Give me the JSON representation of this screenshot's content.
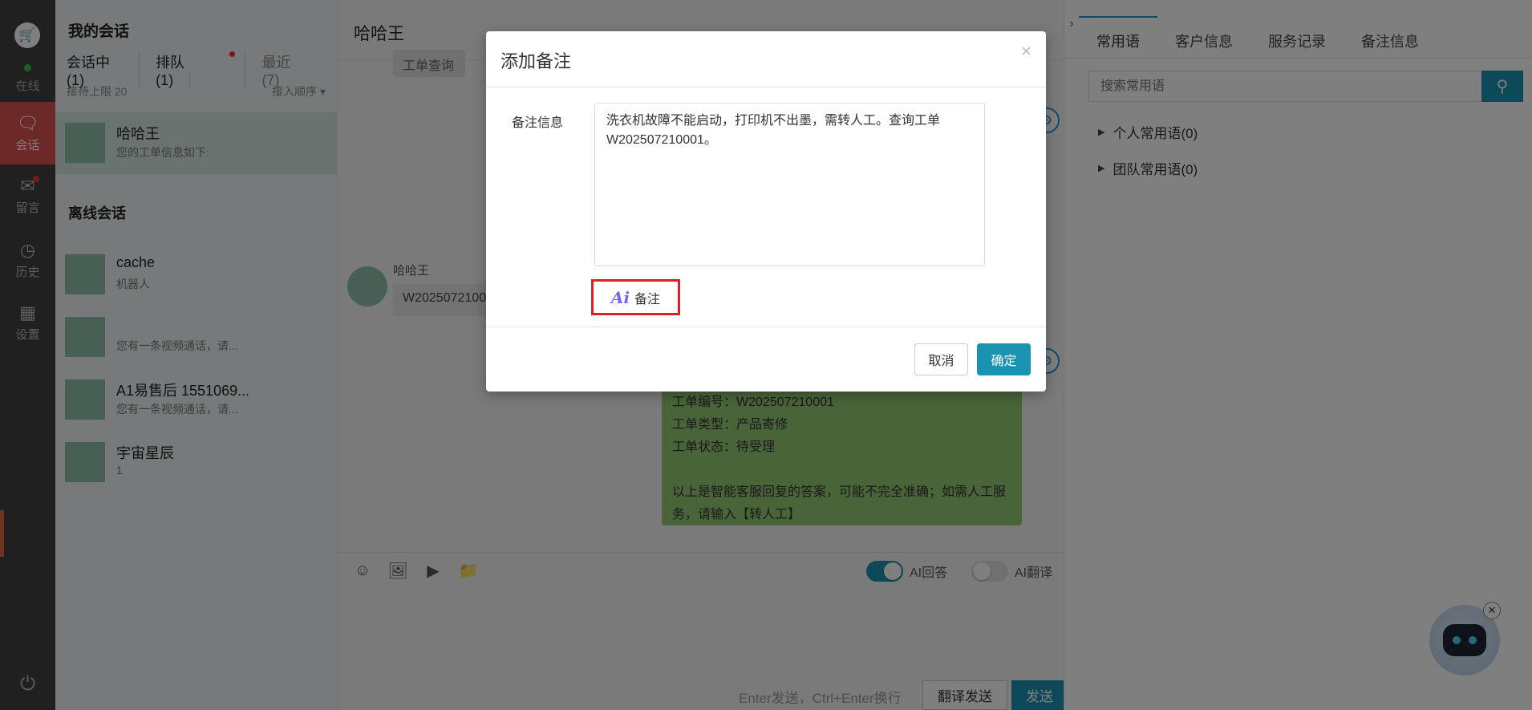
{
  "nav": {
    "status_label": "在线",
    "items": [
      {
        "label": "会话",
        "icon": "chat-icon"
      },
      {
        "label": "留言",
        "icon": "mail-icon"
      },
      {
        "label": "历史",
        "icon": "clock-icon"
      },
      {
        "label": "设置",
        "icon": "grid-icon"
      }
    ]
  },
  "conversations": {
    "header": "我的会话",
    "tabs": [
      "会话中(1)",
      "排队(1)",
      "最近(7)"
    ],
    "limit_text": "接待上限 20",
    "order_label": "接入顺序",
    "active": [
      {
        "name": "哈哈王",
        "preview": "您的工单信息如下:"
      }
    ],
    "offline_header": "离线会话",
    "offline": [
      {
        "name": "cache",
        "preview": "机器人"
      },
      {
        "name": "",
        "preview": "您有一条视频通话，请..."
      },
      {
        "name": "A1易售后 1551069...",
        "preview": "您有一条视频通话，请..."
      },
      {
        "name": "宇宙星辰",
        "preview": "1"
      }
    ]
  },
  "chat": {
    "title": "哈哈王",
    "top_bubble": "工单查询",
    "incoming": {
      "sender": "哈哈王",
      "text": "W202507210001"
    },
    "bot_reply": [
      "工单编号：W202507210001",
      "工单类型：产品寄修",
      "工单状态：待受理",
      "",
      "以上是智能客服回复的答案，可能不完全准确；如需人工服务，请输入【转人工】"
    ],
    "toggles": [
      {
        "label": "AI回答",
        "on": true
      },
      {
        "label": "AI翻译",
        "on": false
      }
    ],
    "hint": "Enter发送，Ctrl+Enter换行",
    "translate_send_label": "翻译发送",
    "send_label": "发送"
  },
  "right_panel": {
    "tabs": [
      "常用语",
      "客户信息",
      "服务记录",
      "备注信息"
    ],
    "search_placeholder": "搜索常用语",
    "groups": [
      "个人常用语(0)",
      "团队常用语(0)"
    ]
  },
  "modal": {
    "title": "添加备注",
    "field_label": "备注信息",
    "note_text": "洗衣机故障不能启动，打印机不出墨，需转人工。查询工单W202507210001。",
    "ai_button_label": "备注",
    "cancel_label": "取消",
    "ok_label": "确定"
  },
  "colors": {
    "accent": "#1a93b0",
    "nav_active": "#d9534f",
    "bot_bubble": "#95c972",
    "highlight_border": "#e02020"
  }
}
